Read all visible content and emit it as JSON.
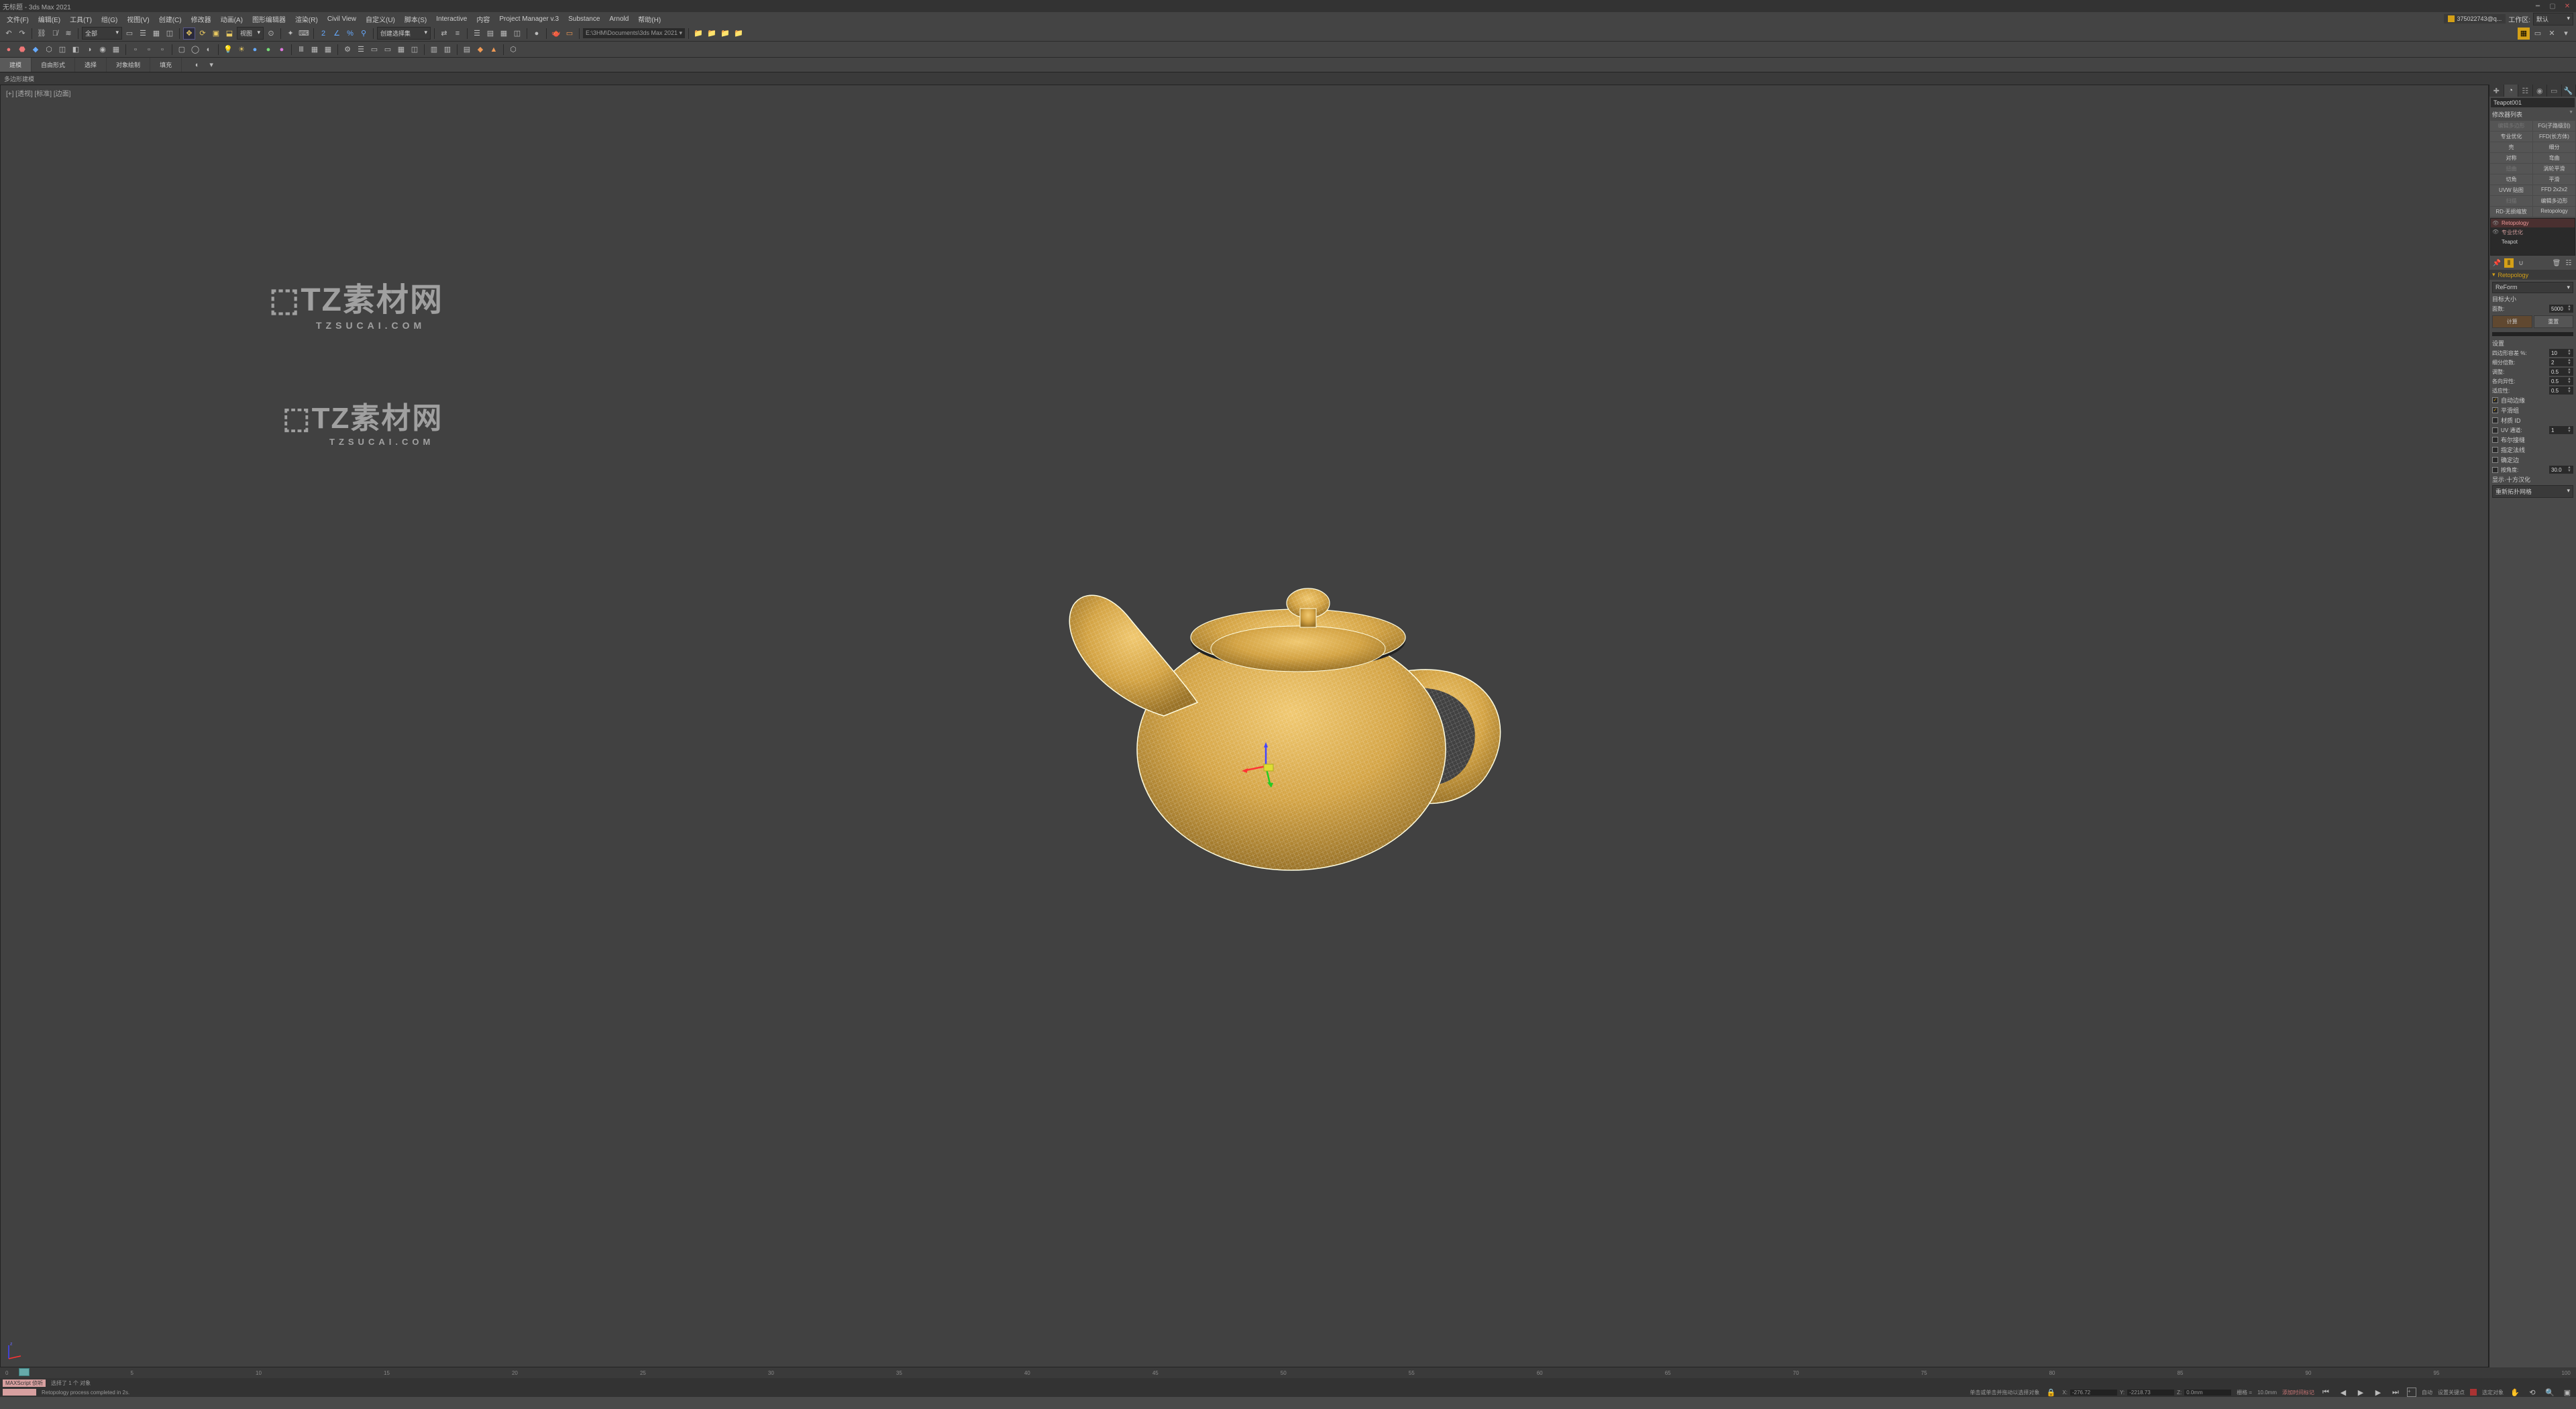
{
  "titlebar": {
    "title": "无标题 - 3ds Max 2021"
  },
  "menubar": {
    "items": [
      "文件(F)",
      "编辑(E)",
      "工具(T)",
      "组(G)",
      "视图(V)",
      "创建(C)",
      "修改器",
      "动画(A)",
      "图形编辑器",
      "渲染(R)",
      "Civil View",
      "自定义(U)",
      "脚本(S)",
      "Interactive",
      "内容",
      "Project Manager v.3",
      "Substance",
      "Arnold",
      "帮助(H)"
    ],
    "user": "375022743@q...",
    "workspace_lbl": "工作区:",
    "workspace_val": "默认"
  },
  "toolbar1": {
    "sel_label": "全部",
    "snap_label": "创建选择集",
    "project_path": "E:\\3HM\\Documents\\3ds Max 2021 ▾"
  },
  "ribbon": {
    "tabs": [
      "建模",
      "自由形式",
      "选择",
      "对象绘制",
      "填充"
    ],
    "sub": "多边形建模"
  },
  "viewport": {
    "label": "[+] [透视] [标准] [边面]"
  },
  "watermarks": {
    "main": "TZ素材网",
    "sub": "TZSUCAI.COM"
  },
  "cmdpanel": {
    "object_name": "Teapot001",
    "modlist_label": "修改器列表",
    "modbuttons": [
      {
        "l": "编辑多边形",
        "dim": true
      },
      {
        "l": "FG(子路级别)"
      },
      {
        "l": "专业优化"
      },
      {
        "l": "FFD(长方体)"
      },
      {
        "l": "壳"
      },
      {
        "l": "细分"
      },
      {
        "l": "对称"
      },
      {
        "l": "弯曲"
      },
      {
        "l": "扭曲",
        "dim": true
      },
      {
        "l": "涡轮平滑"
      },
      {
        "l": "切角"
      },
      {
        "l": "平滑"
      },
      {
        "l": "UVW 贴图"
      },
      {
        "l": "FFD 2x2x2"
      },
      {
        "l": "扫描",
        "dim": true
      },
      {
        "l": "编辑多边形"
      },
      {
        "l": "RD·无损缩放"
      },
      {
        "l": "Retopology"
      }
    ],
    "stack": [
      {
        "name": "Retopology",
        "active": true
      },
      {
        "name": "专业优化"
      },
      {
        "name": "Teapot"
      }
    ],
    "rollout1_title": "Retopology",
    "algo_label": "ReForm",
    "target_label": "目标大小",
    "facecount_label": "面数:",
    "facecount_val": "5000",
    "calc_btn": "计算",
    "reset_btn": "重置",
    "settings_label": "设置",
    "params": {
      "quad_tol_l": "四边形容差 %:",
      "quad_tol_v": "10",
      "subdiv_l": "细分倍数:",
      "subdiv_v": "2",
      "reg_l": "调整:",
      "reg_v": "0.5",
      "aniso_l": "各向异性:",
      "aniso_v": "0.5",
      "adapt_l": "适应性:",
      "adapt_v": "0.5"
    },
    "checks": {
      "autoedge": "自动边缘",
      "autoedge_on": true,
      "smoothgrp": "平滑组",
      "smoothgrp_on": true,
      "matid": "材质 ID",
      "matid_on": false,
      "uvchan": "UV 通道:",
      "uvchan_on": false,
      "uvchan_v": "1",
      "boolseam": "布尔接缝",
      "boolseam_on": false,
      "specnorm": "指定法线",
      "specnorm_on": false,
      "lockedge": "确定边",
      "lockedge_on": false,
      "byangle": "按角度:",
      "byangle_on": false,
      "byangle_v": "30.0"
    },
    "display_label": "显示·十方汉化",
    "display_val": "重新拓扑网格"
  },
  "timeline": {
    "frame": "0 / 100",
    "marks": [
      "0",
      "5",
      "10",
      "15",
      "20",
      "25",
      "30",
      "35",
      "40",
      "45",
      "50",
      "55",
      "60",
      "65",
      "70",
      "75",
      "80",
      "85",
      "90",
      "95",
      "100"
    ]
  },
  "status": {
    "maxscript": "MAXScript 侦听",
    "line1": "选择了 1 个 对象",
    "line2": "Retopology process completed in 2s.",
    "sel_hint": "单击或单击并拖动以选择对象",
    "addtime": "添加时间标记",
    "x_l": "X:",
    "x_v": "-276.72",
    "y_l": "Y:",
    "y_v": "-2218.73",
    "z_l": "Z:",
    "z_v": "0.0mm",
    "grid_l": "栅格 =",
    "grid_v": "10.0mm",
    "autokey": "自动",
    "setkey": "设置关键点",
    "keyfilter": "选定对象"
  }
}
